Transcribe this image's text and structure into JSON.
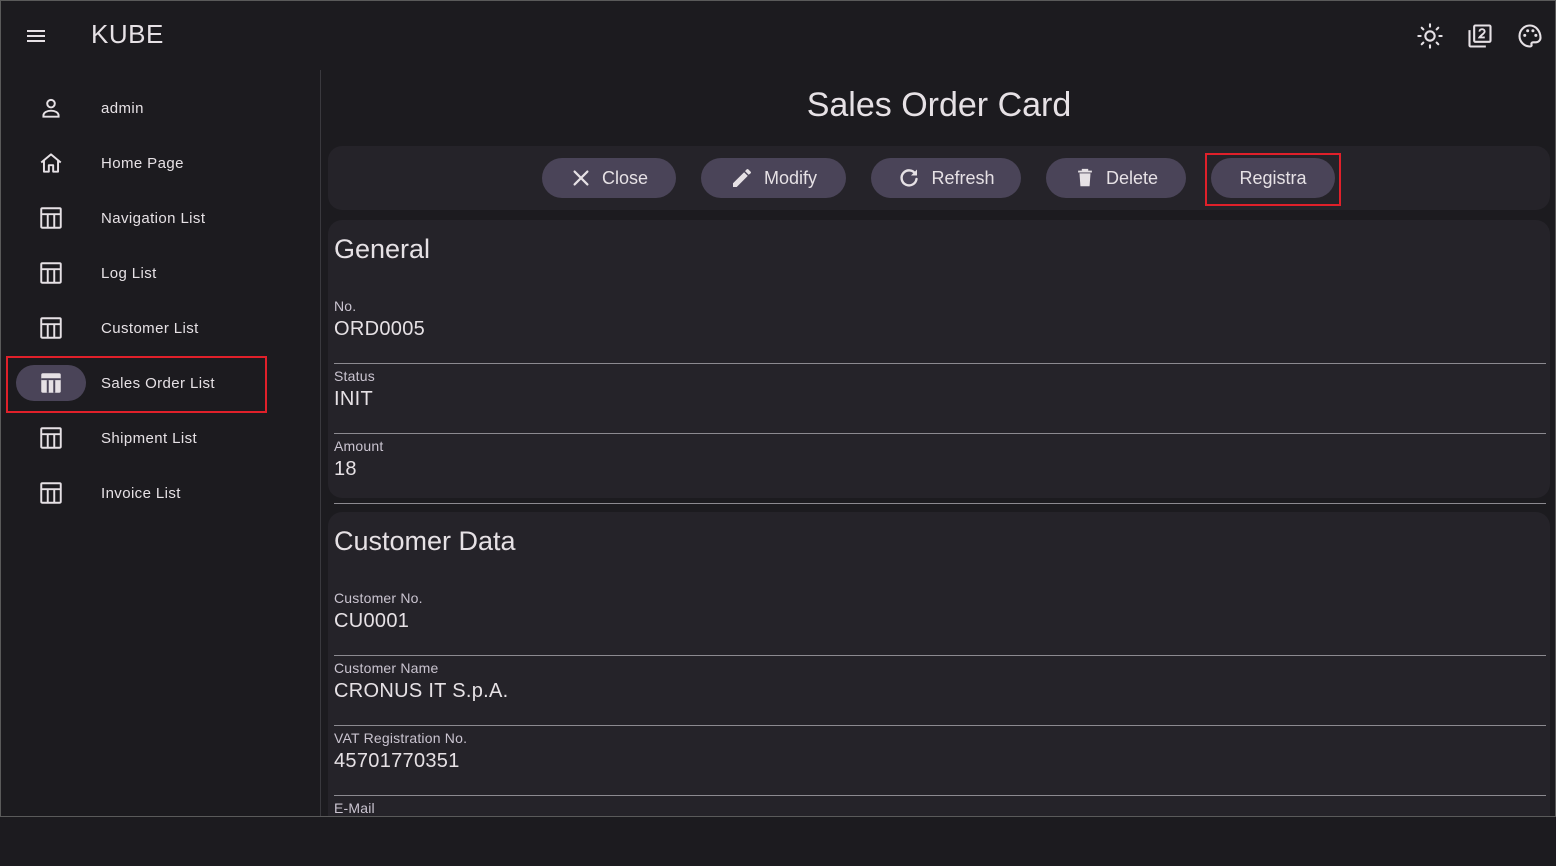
{
  "app": {
    "title": "KUBE"
  },
  "header": {
    "icons": [
      "menu-icon",
      "brightness-icon",
      "filter-2-icon",
      "palette-icon"
    ]
  },
  "sidebar": {
    "items": [
      {
        "label": "admin",
        "icon": "person-icon",
        "active": false
      },
      {
        "label": "Home Page",
        "icon": "home-icon",
        "active": false
      },
      {
        "label": "Navigation List",
        "icon": "table-icon",
        "active": false
      },
      {
        "label": "Log List",
        "icon": "table-icon",
        "active": false
      },
      {
        "label": "Customer List",
        "icon": "table-icon",
        "active": false
      },
      {
        "label": "Sales Order List",
        "icon": "table-icon",
        "active": true
      },
      {
        "label": "Shipment List",
        "icon": "table-icon",
        "active": false
      },
      {
        "label": "Invoice List",
        "icon": "table-icon",
        "active": false
      }
    ]
  },
  "page": {
    "title": "Sales Order Card"
  },
  "toolbar": {
    "close_label": "Close",
    "modify_label": "Modify",
    "refresh_label": "Refresh",
    "delete_label": "Delete",
    "registra_label": "Registra"
  },
  "general": {
    "title": "General",
    "fields": [
      {
        "label": "No.",
        "value": "ORD0005"
      },
      {
        "label": "Status",
        "value": "INIT"
      },
      {
        "label": "Amount",
        "value": "18"
      }
    ]
  },
  "customer": {
    "title": "Customer Data",
    "fields": [
      {
        "label": "Customer No.",
        "value": "CU0001"
      },
      {
        "label": "Customer Name",
        "value": "CRONUS IT S.p.A."
      },
      {
        "label": "VAT Registration No.",
        "value": "45701770351"
      },
      {
        "label": "E-Mail",
        "value": ""
      }
    ]
  },
  "colors": {
    "background": "#1c1b1f",
    "surface": "#252329",
    "button": "#4a4458",
    "highlight": "#e0202a",
    "text": "#e6e1e5"
  }
}
